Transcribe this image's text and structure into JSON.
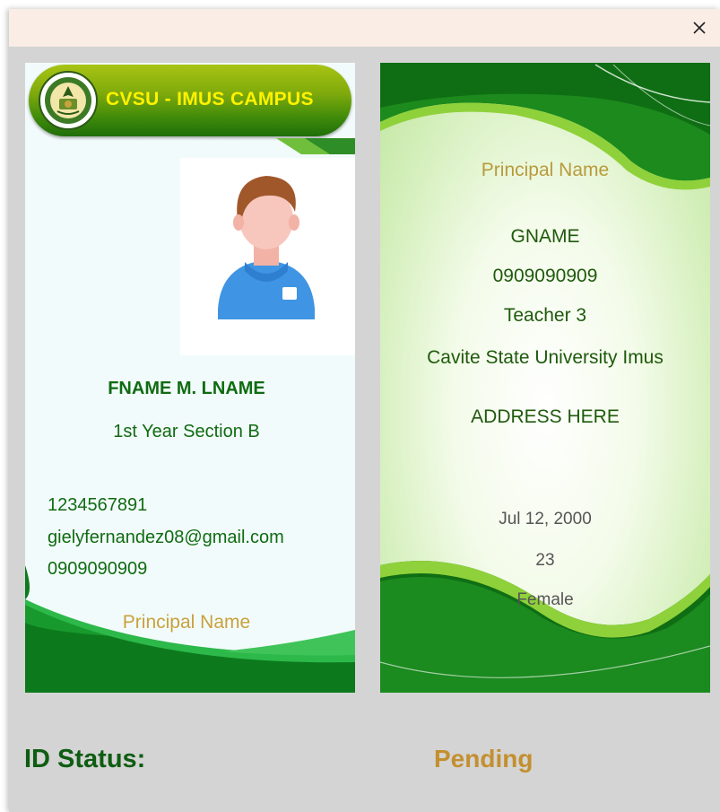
{
  "dialog": {
    "close_icon": "close-icon"
  },
  "front": {
    "campus_name": "CVSU - IMUS CAMPUS",
    "logo_icon": "campus-seal-logo",
    "avatar_icon": "student-avatar-icon",
    "student_name": "FNAME M. LNAME",
    "section": "1st Year Section B",
    "student_id": "1234567891",
    "email": "gielyfernandez08@gmail.com",
    "phone": "0909090909",
    "principal": "Principal Name"
  },
  "back": {
    "principal": "Principal Name",
    "guardian_name": "GNAME",
    "guardian_phone": "0909090909",
    "guardian_position": "Teacher 3",
    "school": "Cavite State University Imus",
    "address": "ADDRESS HERE",
    "birthdate": "Jul 12, 2000",
    "age": "23",
    "gender": "Female"
  },
  "status": {
    "label": "ID Status:",
    "value": "Pending"
  },
  "colors": {
    "primary_green": "#0f6b12",
    "gold": "#c9a13d",
    "panel_bg": "#d4d4d4",
    "titlebar_bg": "#f9ede6"
  }
}
